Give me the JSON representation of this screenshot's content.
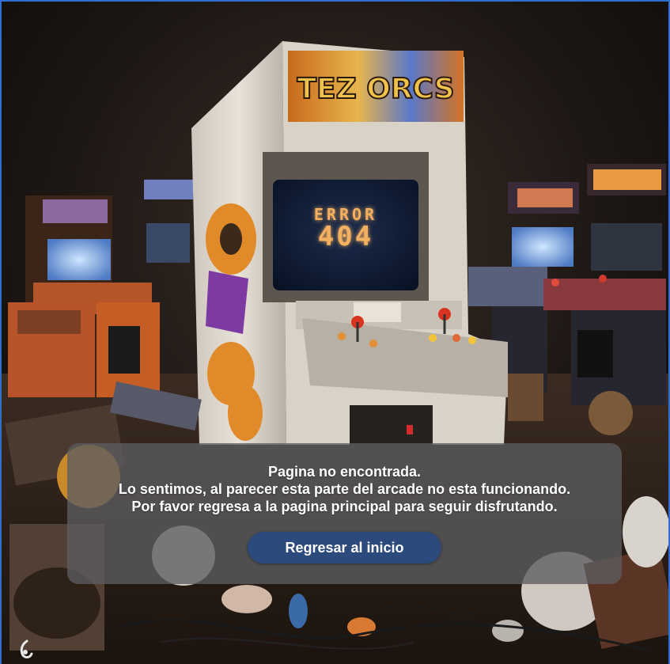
{
  "error_screen": {
    "line1": "ERROR",
    "line2": "404"
  },
  "message": {
    "title": "Pagina no encontrada.",
    "line2": "Lo sentimos, al parecer esta parte del arcade no esta funcionando.",
    "line3": "Por favor regresa a la pagina principal para seguir disfrutando."
  },
  "home_button": {
    "label": "Regresar al inicio"
  },
  "colors": {
    "accent_border": "#2f6fd0",
    "button_bg": "#2c4a7c",
    "screen_text": "#f3b060",
    "screen_bg": "#0e1a33"
  },
  "icons": {
    "corner": "logo-mark-icon"
  }
}
